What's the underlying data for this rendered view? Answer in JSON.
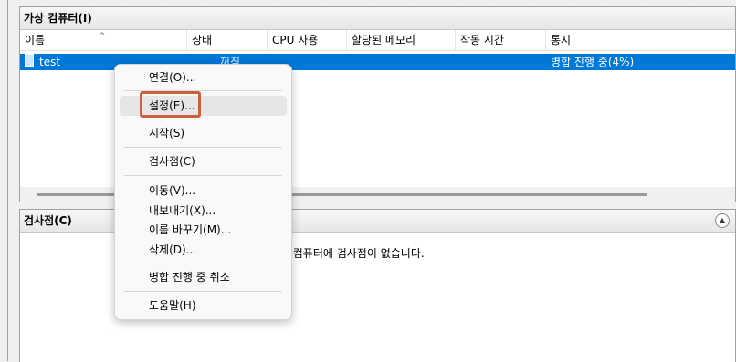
{
  "vm_panel": {
    "title": "가상 컴퓨터(I)",
    "columns": [
      "이름",
      "상태",
      "CPU 사용",
      "할당된 메모리",
      "작동 시간",
      "통지"
    ],
    "rows": [
      {
        "name": "test",
        "state": "꺼짐",
        "cpu": "",
        "memory": "",
        "uptime": "",
        "status": "병합 진행 중(4%)"
      }
    ]
  },
  "checkpoint_panel": {
    "title": "검사점(C)",
    "empty_message": "한 가상 컴퓨터에 검사점이 없습니다."
  },
  "context_menu": {
    "items": [
      "연결(O)...",
      "설정(E)...",
      "시작(S)",
      "검사점(C)",
      "이동(V)...",
      "내보내기(X)...",
      "이름 바꾸기(M)...",
      "삭제(D)...",
      "병합 진행 중 취소",
      "도움말(H)"
    ],
    "hovered": "설정(E)..."
  },
  "colors": {
    "selection": "#0078d7",
    "highlight_border": "#c8613c"
  },
  "icons": [
    "vm-icon",
    "sort-ascending-icon",
    "collapse-icon"
  ]
}
